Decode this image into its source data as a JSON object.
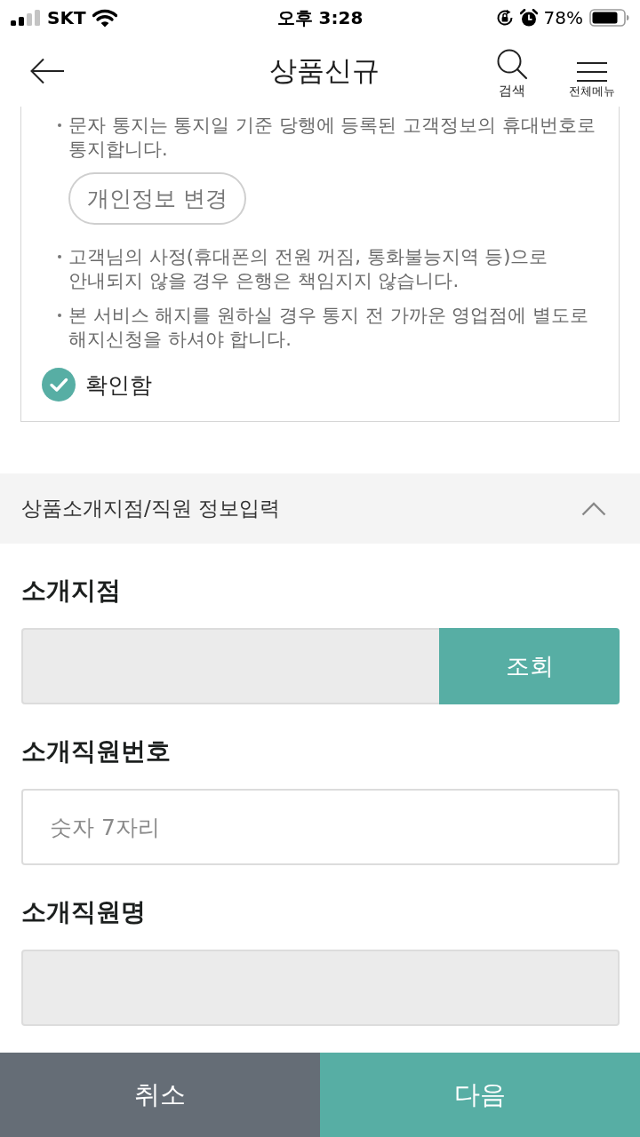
{
  "status_bar": {
    "carrier": "SKT",
    "time": "오후 3:28",
    "battery": "78%"
  },
  "header": {
    "title": "상품신규",
    "actions": [
      {
        "kind": "search",
        "label": "검색"
      },
      {
        "kind": "menu",
        "label": "전체메뉴"
      }
    ]
  },
  "notice": {
    "items": [
      {
        "kind": "bullet",
        "text": "문자 통지는 통지일 기준 당행에 등록된 고객정보의 휴대번호로 통지합니다."
      },
      {
        "kind": "button",
        "label": "개인정보 변경"
      },
      {
        "kind": "bullet",
        "text": "고객님의 사정(휴대폰의 전원 꺼짐, 통화불능지역 등)으로 안내되지 않을 경우 은행은 책임지지 않습니다."
      },
      {
        "kind": "bullet",
        "text": "본 서비스 해지를 원하실 경우 통지 전 가까운 영업점에 별도로 해지신청을 하셔야 합니다."
      }
    ],
    "confirm": {
      "label": "확인함",
      "checked": true
    }
  },
  "section": {
    "title": "상품소개지점/직원 정보입력",
    "expanded": true
  },
  "fields": [
    {
      "kind": "lookup",
      "label": "소개지점",
      "disabled": true,
      "button": "조회"
    },
    {
      "kind": "text",
      "label": "소개직원번호",
      "disabled": false,
      "placeholder": "숫자 7자리"
    },
    {
      "kind": "text",
      "label": "소개직원명",
      "disabled": true
    }
  ],
  "footer": {
    "buttons": [
      {
        "kind": "secondary",
        "label": "취소"
      },
      {
        "kind": "primary",
        "label": "다음"
      }
    ]
  }
}
